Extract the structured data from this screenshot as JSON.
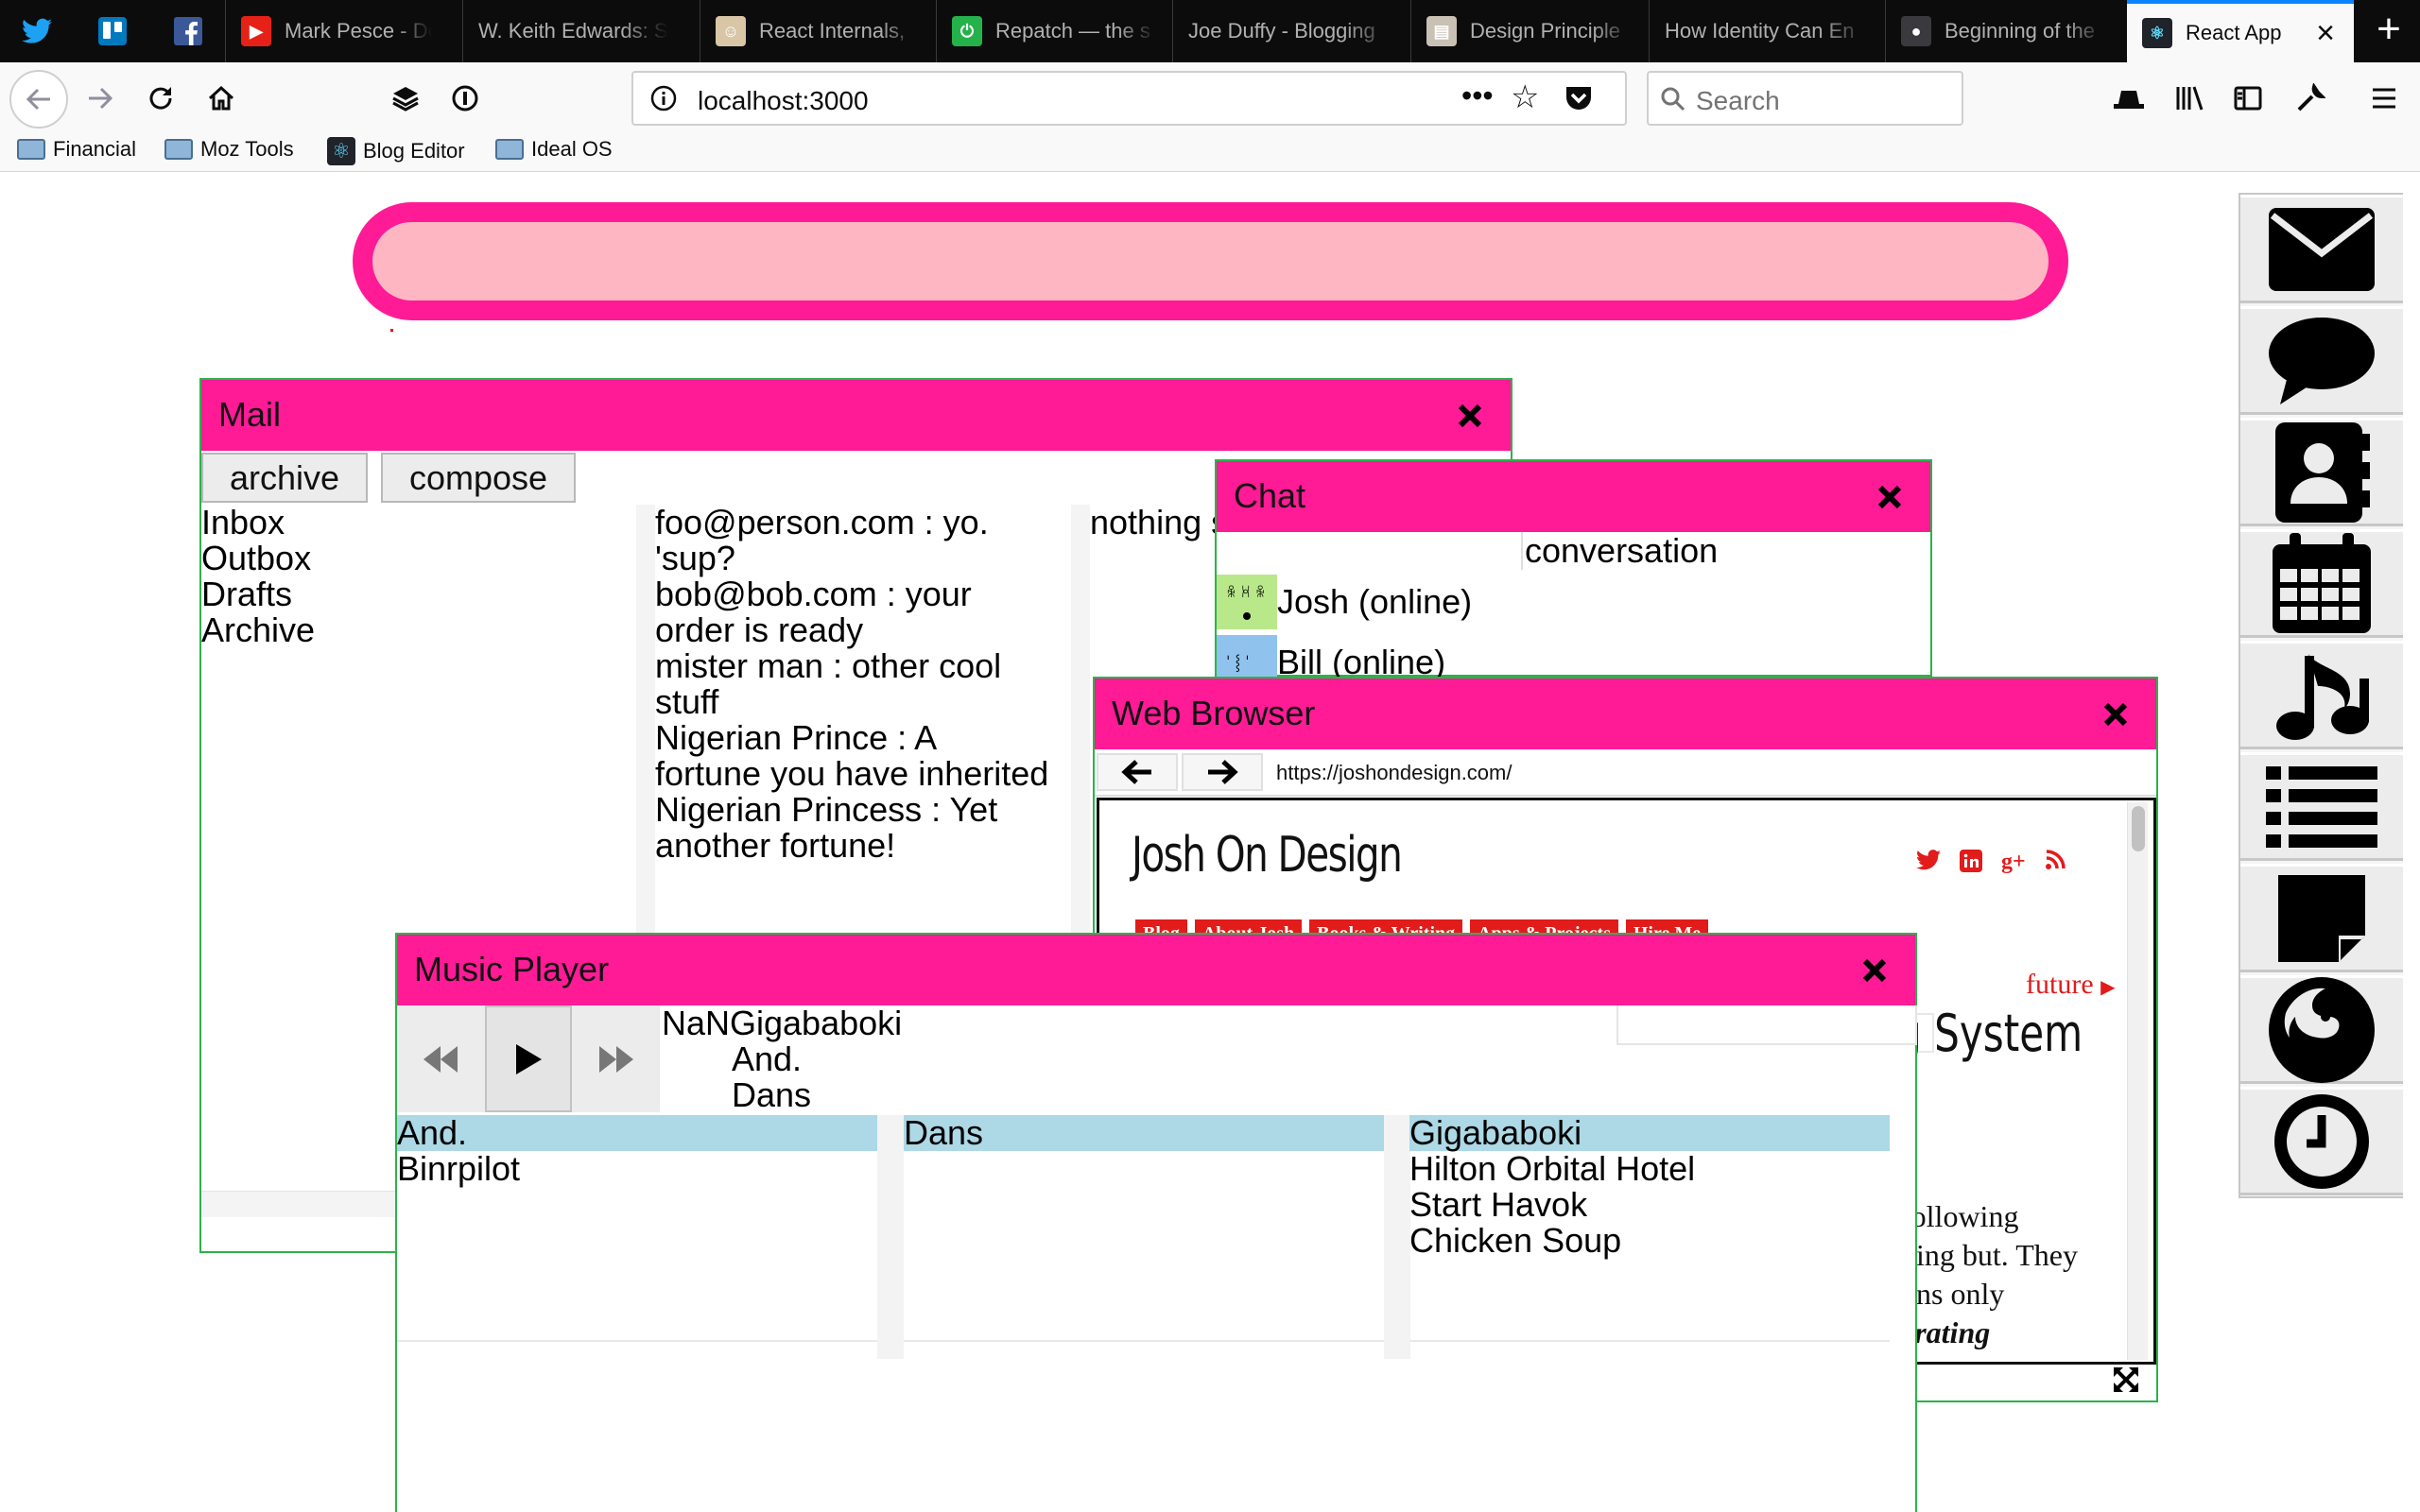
{
  "browser": {
    "pinned_tabs": [
      "twitter-icon",
      "trello-icon",
      "facebook-icon"
    ],
    "tabs": [
      {
        "title": "Mark Pesce - De",
        "icon": "youtube-icon"
      },
      {
        "title": "W. Keith Edwards: S",
        "icon": ""
      },
      {
        "title": "React Internals,",
        "icon": "person-icon"
      },
      {
        "title": "Repatch — the s",
        "icon": "repatch-icon"
      },
      {
        "title": "Joe Duffy - Blogging",
        "icon": ""
      },
      {
        "title": "Design Principle",
        "icon": "book-icon"
      },
      {
        "title": "How Identity Can En",
        "icon": ""
      },
      {
        "title": "Beginning of the",
        "icon": "github-icon"
      },
      {
        "title": "React App",
        "icon": "react-icon",
        "active": true
      }
    ],
    "url": "localhost:3000",
    "search_placeholder": "Search",
    "bookmarks": [
      {
        "label": "Financial",
        "icon": "folder-icon"
      },
      {
        "label": "Moz Tools",
        "icon": "folder-icon"
      },
      {
        "label": "Blog Editor",
        "icon": "react-icon"
      },
      {
        "label": "Ideal OS",
        "icon": "folder-icon"
      }
    ]
  },
  "colors": {
    "accent": "#ff1a96",
    "pill_inner": "#ffb6c3",
    "window_border": "#2bb34a",
    "highlight": "#add8e6"
  },
  "dock": [
    "mail-icon",
    "chat-icon",
    "contacts-icon",
    "calendar-icon",
    "music-icon",
    "list-icon",
    "notes-icon",
    "firefox-icon",
    "clock-icon"
  ],
  "mail": {
    "title": "Mail",
    "buttons": {
      "archive": "archive",
      "compose": "compose"
    },
    "folders": [
      "Inbox",
      "Outbox",
      "Drafts",
      "Archive"
    ],
    "messages": [
      {
        "from": "foo@person.com",
        "subject": "yo. 'sup?"
      },
      {
        "from": "bob@bob.com",
        "subject": "your order is ready"
      },
      {
        "from": "mister man",
        "subject": "other cool stuff"
      },
      {
        "from": "Nigerian Prince",
        "subject": "A fortune you have inherited"
      },
      {
        "from": "Nigerian Princess",
        "subject": "Yet another fortune!"
      }
    ],
    "message_lines": [
      "foo@person.com : yo.",
      "'sup?",
      "bob@bob.com : your",
      "order is ready",
      "mister man : other cool",
      "stuff",
      "Nigerian Prince : A",
      "fortune you have inherited",
      "Nigerian Princess : Yet",
      "another fortune!"
    ],
    "preview": "nothing s"
  },
  "chat": {
    "title": "Chat",
    "users": [
      {
        "name": "Josh (online)",
        "avatar_color": "#b9e88a"
      },
      {
        "name": "Bill (online)",
        "avatar_color": "#8fc3ee"
      }
    ],
    "conversation_label": "conversation"
  },
  "web": {
    "title": "Web Browser",
    "url": "https://joshondesign.com/",
    "site_title": "Josh On Design",
    "nav": [
      "Blog",
      "About Josh",
      "Books & Writing",
      "Apps & Projects",
      "Hire Me"
    ],
    "social": [
      "twitter-icon",
      "linkedin-icon",
      "googleplus-icon",
      "rss-icon"
    ],
    "future_link": "future",
    "heading": "g System",
    "body_lines": [
      "following",
      "hing but. They",
      "ons only",
      "erating"
    ]
  },
  "music": {
    "title": "Music Player",
    "now_playing": {
      "title": "NaNGigababoki",
      "line2": "And.",
      "line3": "Dans"
    },
    "artists": {
      "header": "And.",
      "rows": [
        "Binrpilot"
      ]
    },
    "albums": {
      "header": "Dans",
      "rows": []
    },
    "songs": {
      "header": "Gigababoki",
      "rows": [
        "Hilton Orbital Hotel",
        "Start Havok",
        "Chicken Soup"
      ]
    }
  }
}
